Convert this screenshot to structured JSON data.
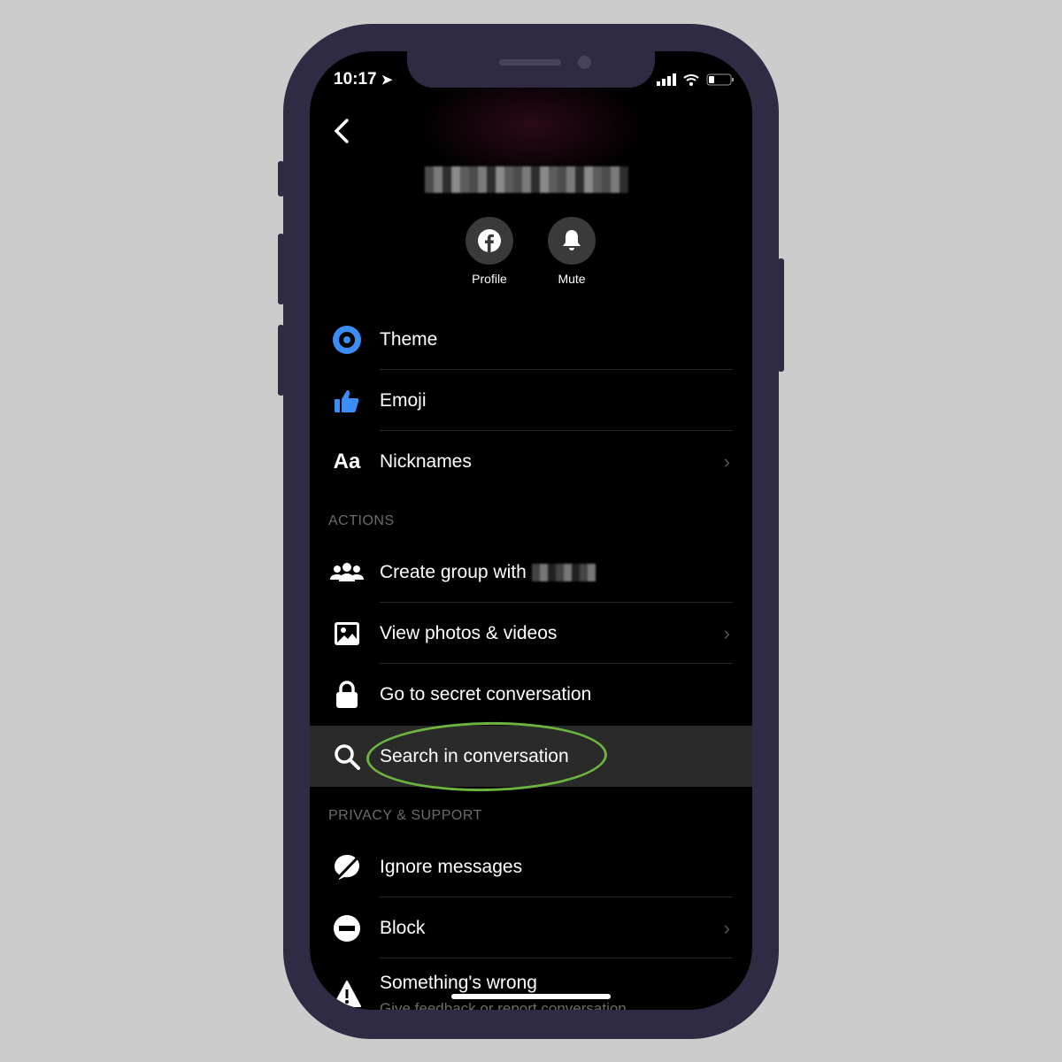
{
  "status_bar": {
    "time": "10:17"
  },
  "header": {
    "buttons": [
      {
        "label": "Profile",
        "icon": "facebook-icon"
      },
      {
        "label": "Mute",
        "icon": "bell-icon"
      }
    ]
  },
  "menu": {
    "customize": [
      {
        "label": "Theme",
        "icon": "theme-icon"
      },
      {
        "label": "Emoji",
        "icon": "thumbs-up-icon"
      },
      {
        "label": "Nicknames",
        "icon": "text-aa-icon",
        "chevron": true
      }
    ],
    "actions_title": "ACTIONS",
    "actions": [
      {
        "label": "Create group with",
        "icon": "group-icon"
      },
      {
        "label": "View photos & videos",
        "icon": "photo-icon",
        "chevron": true
      },
      {
        "label": "Go to secret conversation",
        "icon": "lock-icon"
      },
      {
        "label": "Search in conversation",
        "icon": "search-icon",
        "highlighted": true
      }
    ],
    "privacy_title": "PRIVACY & SUPPORT",
    "privacy": [
      {
        "label": "Ignore messages",
        "icon": "ignore-icon"
      },
      {
        "label": "Block",
        "icon": "block-icon",
        "chevron": true
      },
      {
        "label": "Something's wrong",
        "sublabel": "Give feedback or report conversation",
        "icon": "warning-icon"
      }
    ]
  },
  "colors": {
    "accent": "#3b8cf5",
    "highlight_ring": "#6db33f",
    "frame": "#2f2b45"
  }
}
